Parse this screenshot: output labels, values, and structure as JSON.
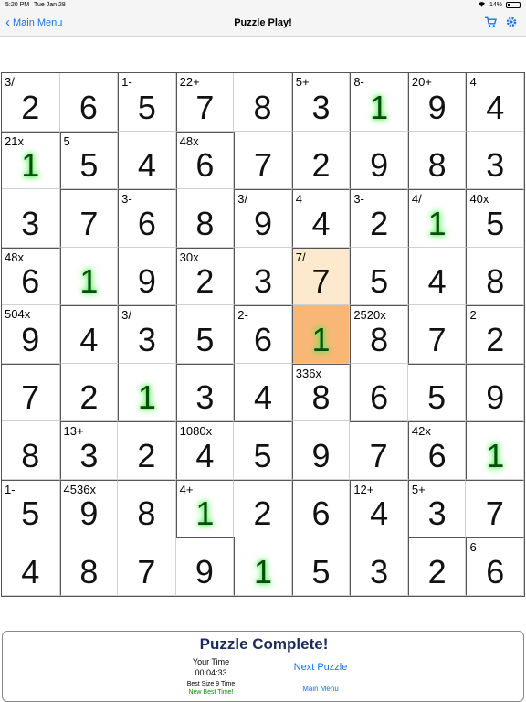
{
  "status_bar": {
    "time": "5:20 PM",
    "date": "Tue Jan 28",
    "battery": "14%"
  },
  "nav": {
    "back_label": "Main Menu",
    "title": "Puzzle Play!",
    "cart_icon": "cart-icon",
    "settings_icon": "gear-icon"
  },
  "board": {
    "size": 9,
    "cells": [
      {
        "v": "2",
        "c": "3/",
        "given": false
      },
      {
        "v": "6",
        "c": "",
        "given": false
      },
      {
        "v": "5",
        "c": "1-",
        "given": false
      },
      {
        "v": "7",
        "c": "22+",
        "given": false
      },
      {
        "v": "8",
        "c": "",
        "given": false
      },
      {
        "v": "3",
        "c": "5+",
        "given": false
      },
      {
        "v": "1",
        "c": "8-",
        "given": true
      },
      {
        "v": "9",
        "c": "20+",
        "given": false
      },
      {
        "v": "4",
        "c": "4",
        "given": false
      },
      {
        "v": "1",
        "c": "21x",
        "given": true
      },
      {
        "v": "5",
        "c": "5",
        "given": false
      },
      {
        "v": "4",
        "c": "",
        "given": false
      },
      {
        "v": "6",
        "c": "48x",
        "given": false
      },
      {
        "v": "7",
        "c": "",
        "given": false
      },
      {
        "v": "2",
        "c": "",
        "given": false
      },
      {
        "v": "9",
        "c": "",
        "given": false
      },
      {
        "v": "8",
        "c": "",
        "given": false
      },
      {
        "v": "3",
        "c": "",
        "given": false
      },
      {
        "v": "3",
        "c": "",
        "given": false
      },
      {
        "v": "7",
        "c": "",
        "given": false
      },
      {
        "v": "6",
        "c": "3-",
        "given": false
      },
      {
        "v": "8",
        "c": "",
        "given": false
      },
      {
        "v": "9",
        "c": "3/",
        "given": false
      },
      {
        "v": "4",
        "c": "4",
        "given": false
      },
      {
        "v": "2",
        "c": "3-",
        "given": false
      },
      {
        "v": "1",
        "c": "4/",
        "given": true
      },
      {
        "v": "5",
        "c": "40x",
        "given": false
      },
      {
        "v": "6",
        "c": "48x",
        "given": false
      },
      {
        "v": "1",
        "c": "",
        "given": true
      },
      {
        "v": "9",
        "c": "",
        "given": false
      },
      {
        "v": "2",
        "c": "30x",
        "given": false
      },
      {
        "v": "3",
        "c": "",
        "given": false
      },
      {
        "v": "7",
        "c": "7/",
        "given": false
      },
      {
        "v": "5",
        "c": "",
        "given": false
      },
      {
        "v": "4",
        "c": "",
        "given": false
      },
      {
        "v": "8",
        "c": "",
        "given": false
      },
      {
        "v": "9",
        "c": "504x",
        "given": false
      },
      {
        "v": "4",
        "c": "",
        "given": false
      },
      {
        "v": "3",
        "c": "3/",
        "given": false
      },
      {
        "v": "5",
        "c": "",
        "given": false
      },
      {
        "v": "6",
        "c": "2-",
        "given": false
      },
      {
        "v": "1",
        "c": "",
        "given": true
      },
      {
        "v": "8",
        "c": "2520x",
        "given": false
      },
      {
        "v": "7",
        "c": "",
        "given": false
      },
      {
        "v": "2",
        "c": "2",
        "given": false
      },
      {
        "v": "7",
        "c": "",
        "given": false
      },
      {
        "v": "2",
        "c": "",
        "given": false
      },
      {
        "v": "1",
        "c": "",
        "given": true
      },
      {
        "v": "3",
        "c": "",
        "given": false
      },
      {
        "v": "4",
        "c": "",
        "given": false
      },
      {
        "v": "8",
        "c": "336x",
        "given": false
      },
      {
        "v": "6",
        "c": "",
        "given": false
      },
      {
        "v": "5",
        "c": "",
        "given": false
      },
      {
        "v": "9",
        "c": "",
        "given": false
      },
      {
        "v": "8",
        "c": "",
        "given": false
      },
      {
        "v": "3",
        "c": "13+",
        "given": false
      },
      {
        "v": "2",
        "c": "",
        "given": false
      },
      {
        "v": "4",
        "c": "1080x",
        "given": false
      },
      {
        "v": "5",
        "c": "",
        "given": false
      },
      {
        "v": "9",
        "c": "",
        "given": false
      },
      {
        "v": "7",
        "c": "",
        "given": false
      },
      {
        "v": "6",
        "c": "42x",
        "given": false
      },
      {
        "v": "1",
        "c": "",
        "given": true
      },
      {
        "v": "5",
        "c": "1-",
        "given": false
      },
      {
        "v": "9",
        "c": "4536x",
        "given": false
      },
      {
        "v": "8",
        "c": "",
        "given": false
      },
      {
        "v": "1",
        "c": "4+",
        "given": true
      },
      {
        "v": "2",
        "c": "",
        "given": false
      },
      {
        "v": "6",
        "c": "",
        "given": false
      },
      {
        "v": "4",
        "c": "12+",
        "given": false
      },
      {
        "v": "3",
        "c": "5+",
        "given": false
      },
      {
        "v": "7",
        "c": "",
        "given": false
      },
      {
        "v": "4",
        "c": "",
        "given": false
      },
      {
        "v": "8",
        "c": "",
        "given": false
      },
      {
        "v": "7",
        "c": "",
        "given": false
      },
      {
        "v": "9",
        "c": "",
        "given": false
      },
      {
        "v": "1",
        "c": "",
        "given": true
      },
      {
        "v": "5",
        "c": "",
        "given": false
      },
      {
        "v": "3",
        "c": "",
        "given": false
      },
      {
        "v": "2",
        "c": "",
        "given": false
      },
      {
        "v": "6",
        "c": "6",
        "given": false
      }
    ],
    "cages": [
      [
        0,
        0,
        1,
        2,
        2,
        3,
        4,
        5,
        6
      ],
      [
        7,
        8,
        1,
        9,
        2,
        3,
        4,
        5,
        6
      ],
      [
        7,
        10,
        11,
        9,
        12,
        13,
        14,
        15,
        16
      ],
      [
        17,
        10,
        11,
        18,
        12,
        19,
        14,
        15,
        16
      ],
      [
        17,
        20,
        21,
        18,
        22,
        19,
        23,
        15,
        24
      ],
      [
        25,
        20,
        21,
        26,
        22,
        27,
        23,
        23,
        28
      ],
      [
        25,
        29,
        29,
        30,
        30,
        27,
        27,
        31,
        32
      ],
      [
        33,
        34,
        34,
        35,
        35,
        36,
        37,
        38,
        38
      ],
      [
        33,
        34,
        34,
        34,
        35,
        36,
        37,
        39,
        40
      ]
    ],
    "selected": [
      4,
      5
    ],
    "highlighted": [
      [
        3,
        5
      ]
    ]
  },
  "completion": {
    "title": "Puzzle Complete!",
    "your_time_label": "Your Time",
    "your_time": "00:04:33",
    "best_label": "Best Size 9 Time",
    "best_note": "New Best Time!",
    "next_label": "Next Puzzle",
    "menu_label": "Main Menu"
  }
}
